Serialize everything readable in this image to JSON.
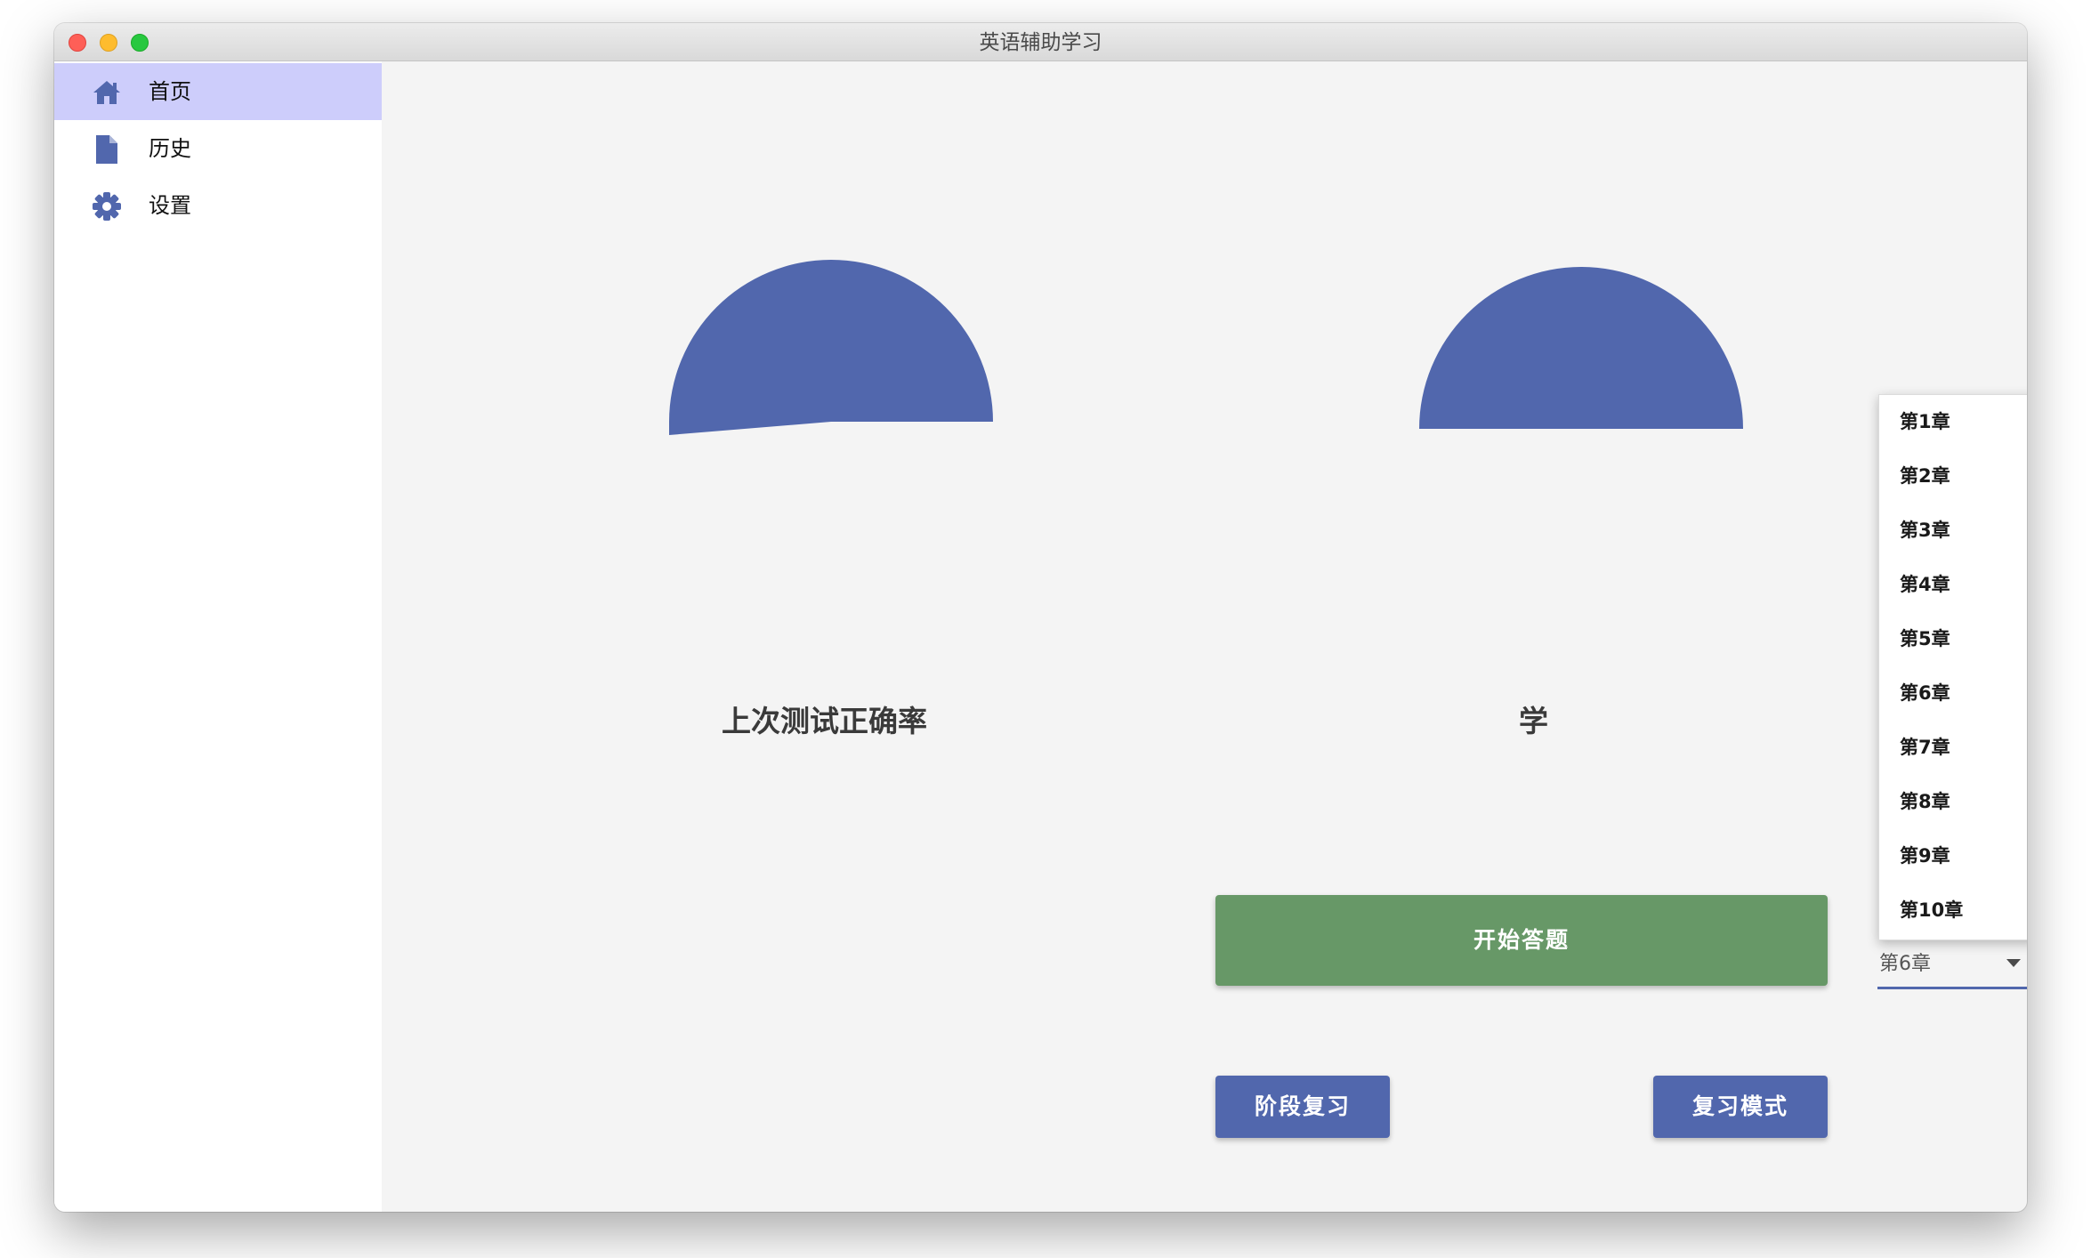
{
  "window": {
    "title": "英语辅助学习"
  },
  "sidebar": {
    "items": [
      {
        "label": "首页",
        "icon": "home-icon",
        "active": true
      },
      {
        "label": "历史",
        "icon": "file-icon",
        "active": false
      },
      {
        "label": "设置",
        "icon": "gear-icon",
        "active": false
      }
    ]
  },
  "main": {
    "gauges": [
      {
        "caption": "上次测试正确率"
      },
      {
        "caption": "学"
      }
    ],
    "start_button": "开始答题",
    "stage_review_button": "阶段复习",
    "review_mode_button": "复习模式",
    "chapter_select": {
      "value": "第6章",
      "options": [
        "第1章",
        "第2章",
        "第3章",
        "第4章",
        "第5章",
        "第6章",
        "第7章",
        "第8章",
        "第9章",
        "第10章"
      ]
    }
  },
  "colors": {
    "accent_blue": "#5167ad",
    "start_green": "#679867",
    "sidebar_active": "#cdcdfb",
    "background": "#f4f4f4"
  }
}
